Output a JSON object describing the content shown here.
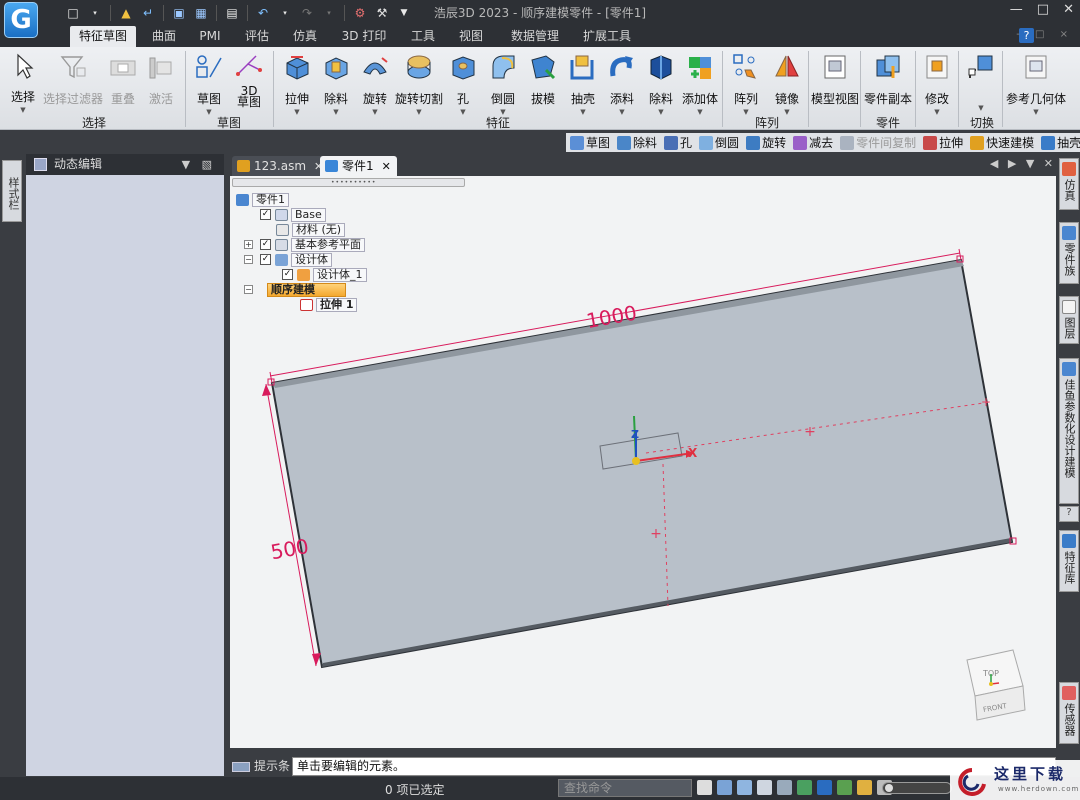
{
  "window": {
    "title": "浩辰3D 2023 - 顺序建模零件 - [零件1]",
    "logo_letter": "G"
  },
  "menu": {
    "tabs": [
      "特征草图",
      "曲面",
      "PMI",
      "评估",
      "仿真",
      "3D 打印",
      "工具",
      "视图",
      "数据管理",
      "扩展工具"
    ],
    "active": "特征草图"
  },
  "ribbon": {
    "buttons": [
      {
        "id": "select",
        "label": "选择",
        "disabled": false
      },
      {
        "id": "select-filter",
        "label": "选择过滤器",
        "disabled": true
      },
      {
        "id": "overlap",
        "label": "重叠",
        "disabled": true
      },
      {
        "id": "activate",
        "label": "激活",
        "disabled": true
      },
      {
        "id": "sketch",
        "label": "草图",
        "disabled": false
      },
      {
        "id": "3d-sketch",
        "label": "3D 草图",
        "disabled": false
      },
      {
        "id": "extrude",
        "label": "拉伸",
        "disabled": false
      },
      {
        "id": "cut",
        "label": "除料",
        "disabled": false
      },
      {
        "id": "revolve",
        "label": "旋转",
        "disabled": false
      },
      {
        "id": "revolve-cut",
        "label": "旋转切割",
        "disabled": false
      },
      {
        "id": "hole",
        "label": "孔",
        "disabled": false
      },
      {
        "id": "round",
        "label": "倒圆",
        "disabled": false
      },
      {
        "id": "draft",
        "label": "拔模",
        "disabled": false
      },
      {
        "id": "shell",
        "label": "抽壳",
        "disabled": false
      },
      {
        "id": "add-material",
        "label": "添料",
        "disabled": false
      },
      {
        "id": "remove-material",
        "label": "除料",
        "disabled": false
      },
      {
        "id": "add-body",
        "label": "添加体",
        "disabled": false
      },
      {
        "id": "pattern",
        "label": "阵列",
        "disabled": false
      },
      {
        "id": "mirror",
        "label": "镜像",
        "disabled": false
      },
      {
        "id": "model-view",
        "label": "模型视图",
        "disabled": false
      },
      {
        "id": "part-copy",
        "label": "零件副本",
        "disabled": false
      },
      {
        "id": "modify",
        "label": "修改",
        "disabled": false
      },
      {
        "id": "switch",
        "label": "",
        "disabled": false
      },
      {
        "id": "ref-geometry",
        "label": "参考几何体",
        "disabled": false
      }
    ],
    "groups": {
      "select": "选择",
      "sketch": "草图",
      "feature": "特征",
      "pattern": "阵列",
      "part": "零件",
      "switch": "切换"
    }
  },
  "subtoolbar": {
    "items": [
      {
        "label": "草图",
        "color": "#5b8fd6",
        "dim": false
      },
      {
        "label": "除料",
        "color": "#4a86c8",
        "dim": false
      },
      {
        "label": "孔",
        "color": "#4a6fb5",
        "dim": false
      },
      {
        "label": "倒圆",
        "color": "#7fb0e0",
        "dim": false
      },
      {
        "label": "旋转",
        "color": "#3d7cc2",
        "dim": false
      },
      {
        "label": "减去",
        "color": "#9a5fc8",
        "dim": false
      },
      {
        "label": "零件间复制",
        "color": "#aab3c0",
        "dim": true
      },
      {
        "label": "拉伸",
        "color": "#c84a4a",
        "dim": false
      },
      {
        "label": "快速建模",
        "color": "#e0a020",
        "dim": false
      },
      {
        "label": "抽壳",
        "color": "#3a7cc8",
        "dim": false
      }
    ]
  },
  "left_strip": {
    "tab": "样式栏"
  },
  "left_panel": {
    "title": "动态编辑"
  },
  "doc_tabs": [
    {
      "label": "123.asm",
      "active": false,
      "icon_color": "#e0a020"
    },
    {
      "label": "零件1",
      "active": true,
      "icon_color": "#3a86d8"
    }
  ],
  "tree": {
    "root": "零件1",
    "base": "Base",
    "material": "材料 (无)",
    "ref_planes": "基本参考平面",
    "design_body": "设计体",
    "design_body_1": "设计体_1",
    "ordered": "顺序建模",
    "extrude": "拉伸 1"
  },
  "model": {
    "dim_length": "1000",
    "dim_width": "500",
    "axis_z": "Z",
    "axis_x": "X",
    "body_color": "#b9c1ca",
    "dim_color": "#d81b5c"
  },
  "navcube": {
    "top": "TOP",
    "front": "FRONT"
  },
  "right_strip": [
    "仿真",
    "零件族",
    "图层",
    "佳鱼参数化设计建模",
    "特征库",
    "传感器"
  ],
  "prompt": {
    "label": "提示条",
    "text": "单击要编辑的元素。"
  },
  "status": {
    "selection": "0 项已选定",
    "command_placeholder": "查找命令"
  },
  "watermark": {
    "text": "这里下载",
    "url": "www.herdown.com"
  }
}
